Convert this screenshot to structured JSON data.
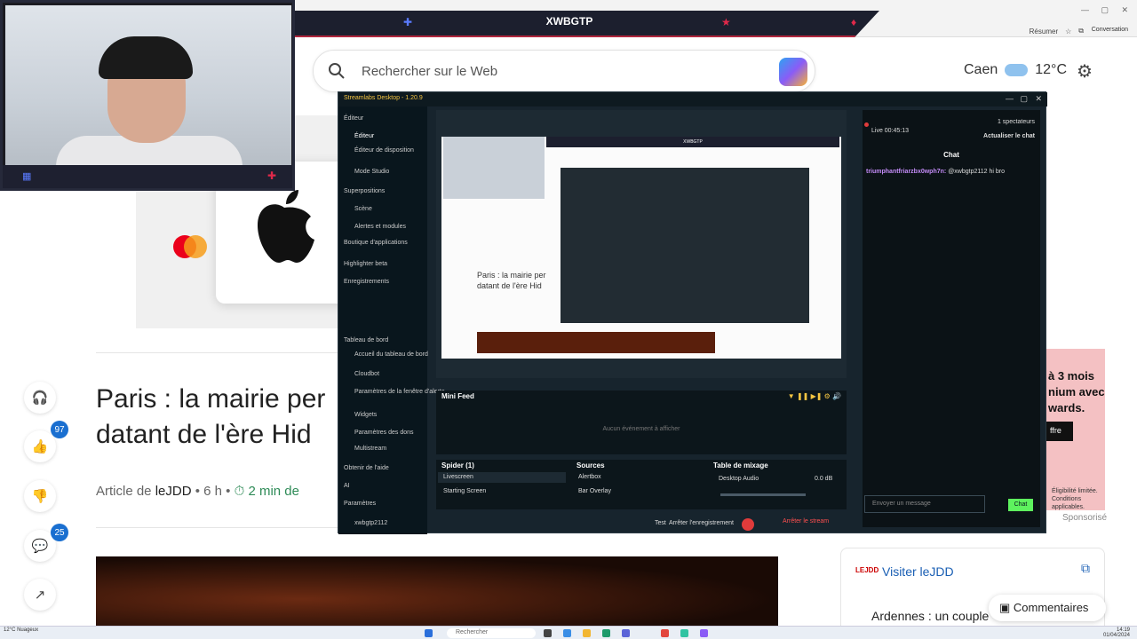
{
  "browser": {
    "search_placeholder": "Rechercher sur le Web",
    "weather_city": "Caen",
    "weather_temp": "12°C",
    "toolbar_summary": "Résumer",
    "conversation": "Conversation"
  },
  "overlay": {
    "channel_name": "XWBGTP"
  },
  "article": {
    "title": "Paris : la mairie per datant de l'ère Hid",
    "byline_prefix": "Article de",
    "byline_source": "leJDD",
    "byline_age": "• 6 h •",
    "byline_read": "⏱ 2 min de",
    "likes": "97",
    "comments_count": "25"
  },
  "ad": {
    "text": "à 3 mois nium avec wards.",
    "button": "ffre",
    "fine": "Éligibilité limitée. Conditions applicables.",
    "sponsored": "Sponsorisé"
  },
  "visit": {
    "logo": "LEJDD",
    "label": "Visiter leJDD",
    "teaser": "Ardennes : un couple"
  },
  "comments_button": "Commentaires",
  "streamlabs": {
    "title": "Streamlabs Desktop - 1.20.9",
    "sidebar": [
      {
        "label": "Éditeur",
        "sub": false,
        "active": false
      },
      {
        "label": "Éditeur",
        "sub": true,
        "active": true
      },
      {
        "label": "Éditeur de disposition",
        "sub": true,
        "active": false
      },
      {
        "label": "Mode Studio",
        "sub": true,
        "active": false
      },
      {
        "label": "Superpositions",
        "sub": false,
        "active": false
      },
      {
        "label": "Scène",
        "sub": true,
        "active": false
      },
      {
        "label": "Alertes et modules",
        "sub": true,
        "active": false
      },
      {
        "label": "Boutique d'applications",
        "sub": false,
        "active": false
      },
      {
        "label": "Highlighter beta",
        "sub": false,
        "active": false
      },
      {
        "label": "Enregistrements",
        "sub": false,
        "active": false
      },
      {
        "label": "Tableau de bord",
        "sub": false,
        "active": false
      },
      {
        "label": "Accueil du tableau de bord",
        "sub": true,
        "active": false
      },
      {
        "label": "Cloudbot",
        "sub": true,
        "active": false
      },
      {
        "label": "Paramètres de la fenêtre d'alerte",
        "sub": true,
        "active": false
      },
      {
        "label": "Widgets",
        "sub": true,
        "active": false
      },
      {
        "label": "Paramètres des dons",
        "sub": true,
        "active": false
      },
      {
        "label": "Multistream",
        "sub": true,
        "active": false
      },
      {
        "label": "Obtenir de l'aide",
        "sub": false,
        "active": false
      },
      {
        "label": "AI",
        "sub": false,
        "active": false
      },
      {
        "label": "Paramètres",
        "sub": false,
        "active": false
      },
      {
        "label": "xwbgtp2112",
        "sub": true,
        "active": false
      }
    ],
    "minifeed_title": "Mini Feed",
    "minifeed_empty": "Aucun événement à afficher",
    "scenes_title": "Spider (1)",
    "scenes": [
      "Livescreen",
      "Starting Screen"
    ],
    "sources_title": "Sources",
    "sources": [
      "Alertbox",
      "Bar Overlay"
    ],
    "mixer_title": "Table de mixage",
    "mixer_source": "Desktop Audio",
    "mixer_level": "0.0 dB",
    "test_label": "Test",
    "stop_recording": "Arrêter l'enregistrement",
    "rec_label": "REC",
    "stop_stream": "Arrêter le stream",
    "live_time": "Live 00:45:13",
    "viewers": "1 spectateurs",
    "refresh_chat": "Actualiser le chat",
    "chat_title": "Chat",
    "chat_user": "triumphantfriarzbx0wph7n:",
    "chat_text": "@xwbgtp2112 hi bro",
    "chat_placeholder": "Envoyer un message",
    "chat_send": "Chat"
  },
  "preview": {
    "mini_title": "Paris : la mairie per datant de l'ère Hid",
    "mini_byline": "Article de leJDD"
  },
  "taskbar": {
    "weather": "12°C Nuageux",
    "search": "Rechercher",
    "time": "14:19",
    "date": "01/04/2024"
  },
  "colors": {
    "accent_red": "#e03b3b",
    "streamlabs_bg": "#17242d",
    "chat_send": "#5ef25e",
    "link_blue": "#1a5fb4"
  }
}
